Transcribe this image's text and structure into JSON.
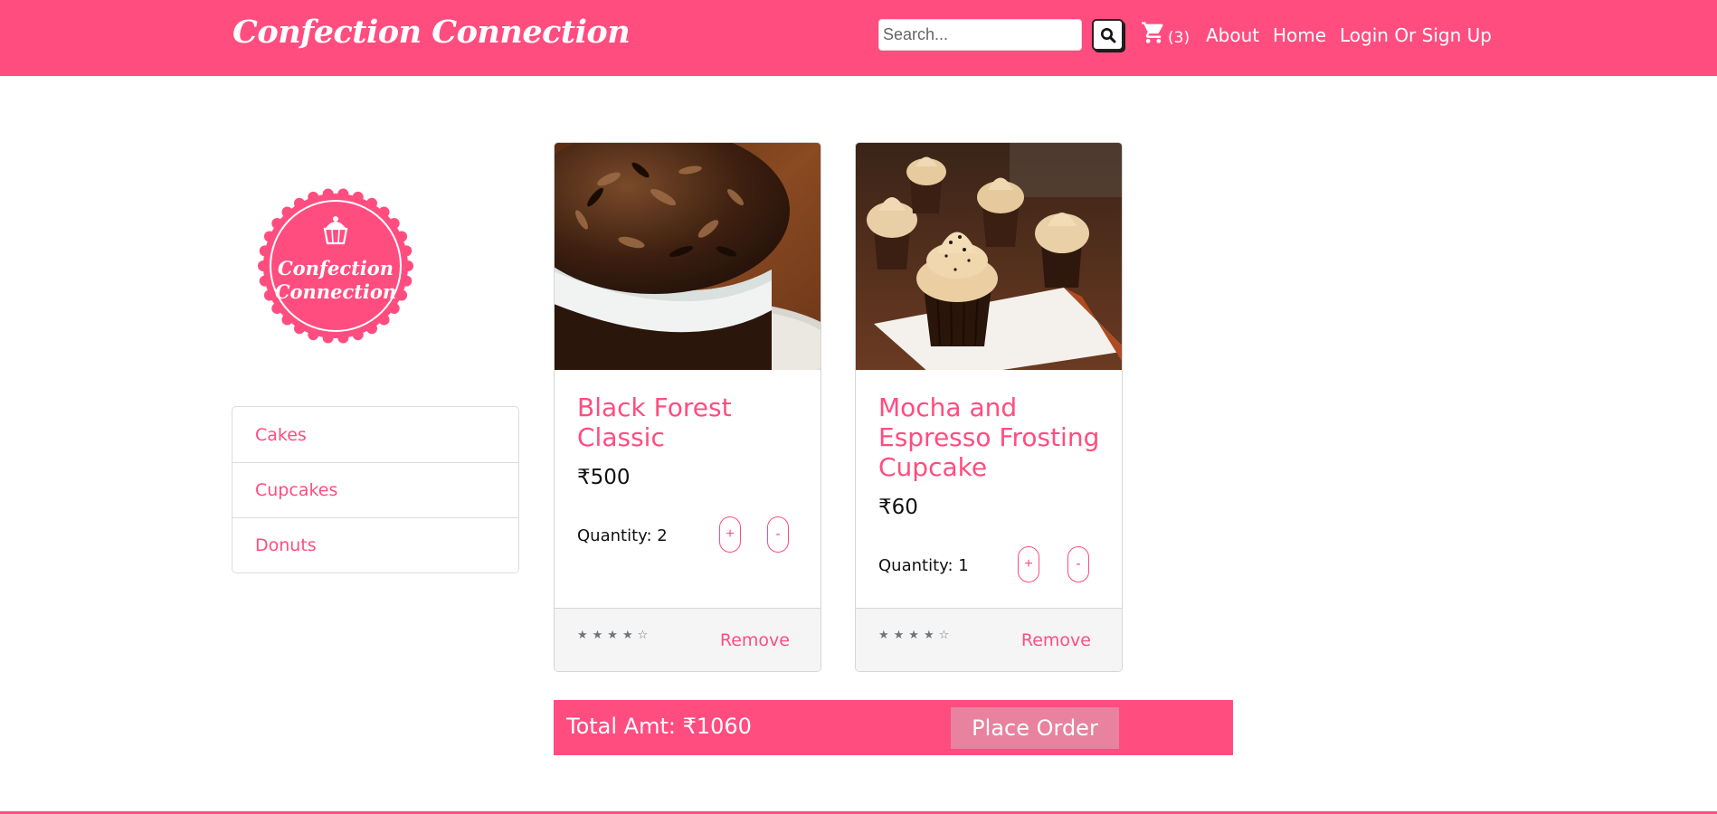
{
  "navbar": {
    "brand": "Confection Connection",
    "search": {
      "placeholder": "Search...",
      "icon": "search-icon"
    },
    "cart": {
      "icon": "cart-icon",
      "count": "(3)"
    },
    "links": {
      "about": "About",
      "home": "Home",
      "login": "Login Or Sign Up"
    }
  },
  "sidebar": {
    "logo": {
      "line1": "Confection",
      "line2": "Connection",
      "icon": "cupcake-icon"
    },
    "categories": [
      "Cakes",
      "Cupcakes",
      "Donuts"
    ]
  },
  "cart_items": [
    {
      "name": "Black Forest Classic",
      "price": "₹500",
      "quantity": "Quantity: 2",
      "plus": "+",
      "minus": "-",
      "rating_stars": "★★★★☆",
      "rating": 4,
      "remove": "Remove"
    },
    {
      "name": "Mocha and Espresso Frosting Cupcake",
      "price": "₹60",
      "quantity": "Quantity: 1",
      "plus": "+",
      "minus": "-",
      "rating_stars": "★★★★☆",
      "rating": 4,
      "remove": "Remove"
    }
  ],
  "order": {
    "total": "Total Amt: ₹1060",
    "place_order": "Place Order"
  },
  "colors": {
    "brand_pink": "#ff4d80",
    "button_pink_light": "#e8829f",
    "footer_gray": "#f5f5f5"
  }
}
